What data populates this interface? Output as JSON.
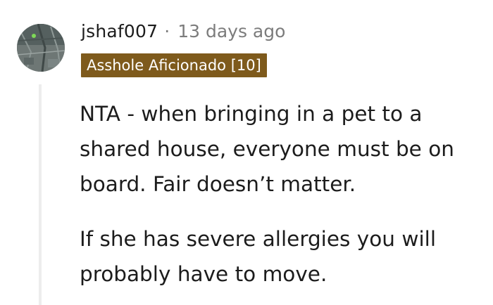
{
  "comment": {
    "author": "jshaf007",
    "separator": "·",
    "timestamp": "13 days ago",
    "flair": "Asshole Aficionado [10]",
    "paragraphs": [
      "NTA - when bringing in a pet to a shared house, everyone must be on board. Fair doesn’t matter.",
      "If she has severe allergies you will probably have to move."
    ],
    "flair_color": "#7e5a1c",
    "text_color": "#1c1c1c",
    "meta_color": "#7c7c7c"
  }
}
